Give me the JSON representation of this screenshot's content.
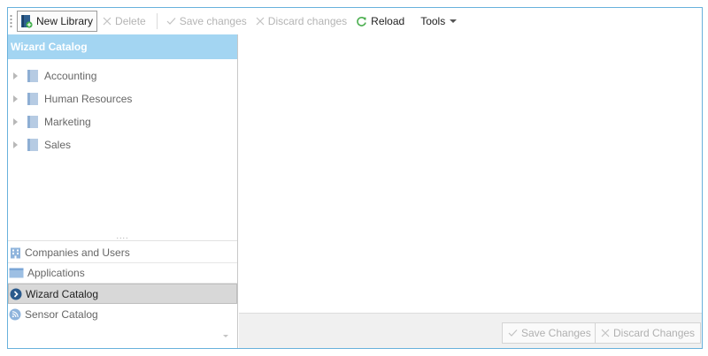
{
  "toolbar": {
    "new_library": "New Library",
    "delete": "Delete",
    "save_changes": "Save changes",
    "discard_changes": "Discard changes",
    "reload": "Reload",
    "tools": "Tools"
  },
  "left_panel": {
    "header": "Wizard Catalog",
    "tree": [
      {
        "label": "Accounting"
      },
      {
        "label": "Human Resources"
      },
      {
        "label": "Marketing"
      },
      {
        "label": "Sales"
      }
    ],
    "splitter": "....",
    "nav": [
      {
        "label": "Companies and Users",
        "icon": "building-icon"
      },
      {
        "label": "Applications",
        "icon": "window-icon"
      },
      {
        "label": "Wizard Catalog",
        "icon": "chevron-circle-icon",
        "active": true
      },
      {
        "label": "Sensor Catalog",
        "icon": "rss-circle-icon"
      }
    ]
  },
  "footer": {
    "save_changes": "Save Changes",
    "discard_changes": "Discard Changes"
  },
  "colors": {
    "accent_border": "#68b1dc",
    "header_bg": "#a3d5f2",
    "reload_green": "#4caf50"
  }
}
